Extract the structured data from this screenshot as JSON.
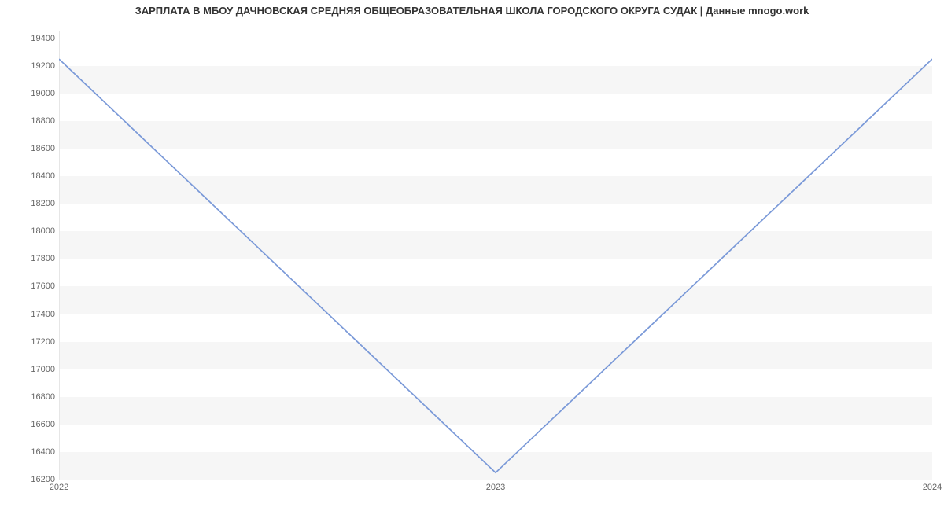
{
  "chart_data": {
    "type": "line",
    "title": "ЗАРПЛАТА В МБОУ ДАЧНОВСКАЯ СРЕДНЯЯ ОБЩЕОБРАЗОВАТЕЛЬНАЯ ШКОЛА ГОРОДСКОГО ОКРУГА СУДАК | Данные mnogo.work",
    "x_categories": [
      "2022",
      "2023",
      "2024"
    ],
    "y_ticks": [
      16200,
      16400,
      16600,
      16800,
      17000,
      17200,
      17400,
      17600,
      17800,
      18000,
      18200,
      18400,
      18600,
      18800,
      19000,
      19200,
      19400
    ],
    "ylim": [
      16200,
      19450
    ],
    "series": [
      {
        "name": "salary",
        "values": [
          19250,
          16250,
          19250
        ]
      }
    ],
    "line_color": "#7a99d8"
  }
}
